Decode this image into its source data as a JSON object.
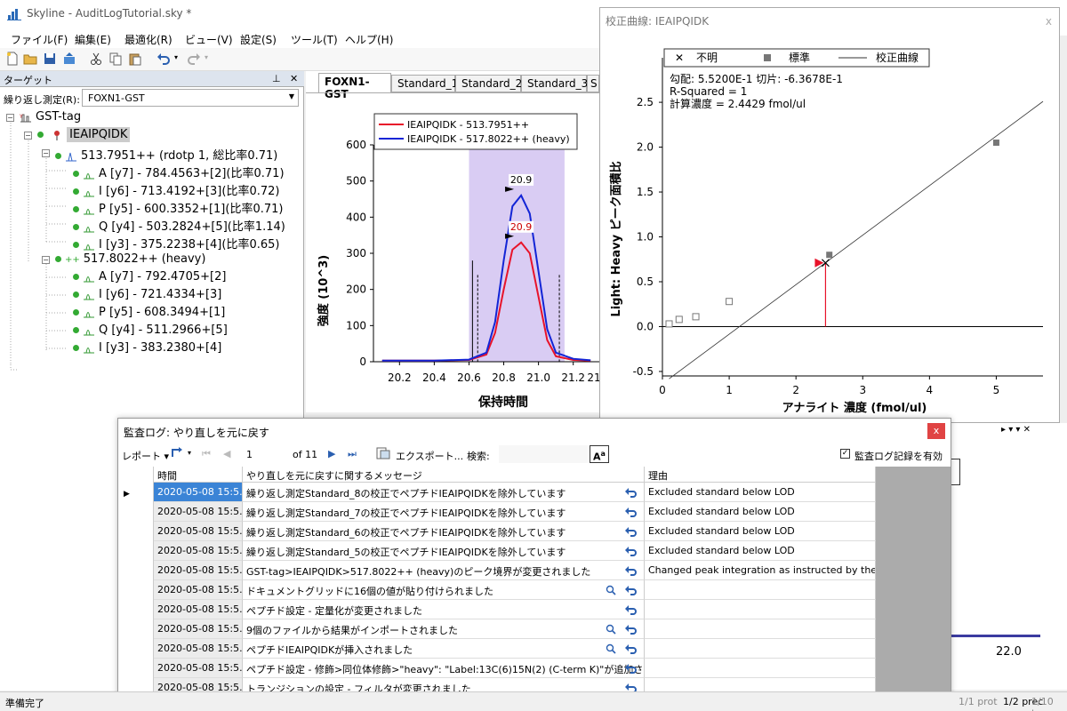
{
  "window": {
    "title": "Skyline - AuditLogTutorial.sky *"
  },
  "menu": [
    "ファイル(F)",
    "編集(E)",
    "最適化(R)",
    "ビュー(V)",
    "設定(S)",
    "ツール(T)",
    "ヘルプ(H)"
  ],
  "targets": {
    "header": "ターゲット",
    "replicate_label": "繰り返し測定(R):",
    "replicate_value": "FOXN1-GST",
    "tree": [
      {
        "text": "GST-tag"
      },
      {
        "text": "IEAIPQIDK"
      },
      {
        "text": "513.7951++ (rdotp 1, 総比率0.71)"
      },
      {
        "text": "A [y7] - 784.4563+[2](比率0.71)"
      },
      {
        "text": "I [y6] - 713.4192+[3](比率0.72)"
      },
      {
        "text": "P [y5] - 600.3352+[1](比率0.71)"
      },
      {
        "text": "Q [y4] - 503.2824+[5](比率1.14)"
      },
      {
        "text": "I [y3] - 375.2238+[4](比率0.65)"
      },
      {
        "text": "517.8022++ (heavy)"
      },
      {
        "text": "A [y7] - 792.4705+[2]"
      },
      {
        "text": "I [y6] - 721.4334+[3]"
      },
      {
        "text": "P [y5] - 608.3494+[1]"
      },
      {
        "text": "Q [y4] - 511.2966+[5]"
      },
      {
        "text": "I [y3] - 383.2380+[4]"
      }
    ]
  },
  "chrom": {
    "tabs": [
      "FOXN1-GST",
      "Standard_1",
      "Standard_2",
      "Standard_3",
      "S"
    ],
    "legend": [
      "IEAIPQIDK - 513.7951++",
      "IEAIPQIDK - 517.8022++ (heavy)"
    ],
    "ylabel": "強度 (10^3)",
    "xlabel": "保持時間",
    "yticks": [
      "600",
      "500",
      "400",
      "300",
      "200",
      "100",
      "0"
    ],
    "xticks": [
      "20.2",
      "20.4",
      "20.6",
      "20.8",
      "21.0",
      "21.2"
    ],
    "xticks_last_partial": "21",
    "peak_labels": [
      "20.9",
      "20.9"
    ],
    "colors": {
      "light": "#e8132a",
      "heavy": "#1325d6",
      "band": "#d9ccf3"
    }
  },
  "chart_data": {
    "type": "line",
    "title": "",
    "xlabel": "保持時間",
    "ylabel": "強度 (10^3)",
    "xlim": [
      20.05,
      21.35
    ],
    "ylim": [
      0,
      600
    ],
    "series": [
      {
        "name": "IEAIPQIDK - 513.7951++",
        "x": [
          20.1,
          20.4,
          20.6,
          20.7,
          20.75,
          20.8,
          20.85,
          20.9,
          20.95,
          21.0,
          21.05,
          21.1,
          21.2,
          21.3
        ],
        "y": [
          3,
          3,
          5,
          20,
          80,
          200,
          310,
          330,
          300,
          180,
          60,
          15,
          5,
          3
        ]
      },
      {
        "name": "IEAIPQIDK - 517.8022++ (heavy)",
        "x": [
          20.1,
          20.4,
          20.6,
          20.7,
          20.75,
          20.8,
          20.85,
          20.9,
          20.95,
          21.0,
          21.05,
          21.1,
          21.2,
          21.3
        ],
        "y": [
          3,
          3,
          6,
          25,
          110,
          280,
          430,
          460,
          410,
          250,
          90,
          25,
          8,
          4
        ]
      }
    ]
  },
  "calib": {
    "title": "校正曲線: IEAIPQIDK",
    "close": "x",
    "legend": [
      "不明",
      "標準",
      "校正曲線"
    ],
    "stats": [
      "勾配: 5.5200E-1 切片: -6.3678E-1",
      "R-Squared = 1",
      "計算濃度 = 2.4429 fmol/ul"
    ],
    "ylabel": "Light: Heavy ピーク面積比",
    "xlabel": "アナライト 濃度 (fmol/ul)",
    "yticks": [
      "2.5",
      "2.0",
      "1.5",
      "1.0",
      "0.5",
      "0.0",
      "-0.5"
    ],
    "xticks": [
      "0",
      "1",
      "2",
      "3",
      "4",
      "5"
    ]
  },
  "calib_data": {
    "type": "scatter",
    "xlabel": "アナライト 濃度 (fmol/ul)",
    "ylabel": "Light: Heavy ピーク面積比",
    "xlim": [
      0,
      5.7
    ],
    "ylim": [
      -0.55,
      2.6
    ],
    "standards_included": [
      {
        "x": 2.5,
        "y": 0.8
      },
      {
        "x": 5.0,
        "y": 2.05
      }
    ],
    "standards_excluded": [
      {
        "x": 0.1,
        "y": 0.03
      },
      {
        "x": 0.25,
        "y": 0.08
      },
      {
        "x": 0.5,
        "y": 0.11
      },
      {
        "x": 1.0,
        "y": 0.28
      }
    ],
    "unknown": {
      "x": 2.4429,
      "y": 0.71
    },
    "fit": {
      "slope": 0.552,
      "intercept": -0.63678
    }
  },
  "right_panel": {
    "tick": "22.0"
  },
  "audit": {
    "title": "監査ログ: やり直しを元に戻す",
    "close": "x",
    "toolbar": {
      "report": "レポート",
      "page": "1",
      "of": "of 11",
      "export": "エクスポート...",
      "search": "検索:",
      "enable": "監査ログ記録を有効"
    },
    "columns": [
      "時間",
      "やり直しを元に戻すに関するメッセージ",
      "理由"
    ],
    "rows": [
      {
        "time": "2020-05-08 15:5...",
        "msg": "繰り返し測定Standard_8の校正でペプチドIEAIPQIDKを除外しています",
        "reason": "Excluded standard below LOD",
        "zoom": false
      },
      {
        "time": "2020-05-08 15:5...",
        "msg": "繰り返し測定Standard_7の校正でペプチドIEAIPQIDKを除外しています",
        "reason": "Excluded standard below LOD",
        "zoom": false
      },
      {
        "time": "2020-05-08 15:5...",
        "msg": "繰り返し測定Standard_6の校正でペプチドIEAIPQIDKを除外しています",
        "reason": "Excluded standard below LOD",
        "zoom": false
      },
      {
        "time": "2020-05-08 15:5...",
        "msg": "繰り返し測定Standard_5の校正でペプチドIEAIPQIDKを除外しています",
        "reason": "Excluded standard below LOD",
        "zoom": false
      },
      {
        "time": "2020-05-08 15:5...",
        "msg": "GST-tag>IEAIPQIDK>517.8022++ (heavy)のピーク境界が変更されました",
        "reason": "Changed peak integration as instructed by the tutorial",
        "zoom": false
      },
      {
        "time": "2020-05-08 15:5...",
        "msg": "ドキュメントグリッドに16個の値が貼り付けられました",
        "reason": "",
        "zoom": true
      },
      {
        "time": "2020-05-08 15:5...",
        "msg": "ペプチド設定 - 定量化が変更されました",
        "reason": "",
        "zoom": false
      },
      {
        "time": "2020-05-08 15:5...",
        "msg": "9個のファイルから結果がインポートされました",
        "reason": "",
        "zoom": true
      },
      {
        "time": "2020-05-08 15:5...",
        "msg": "ペプチドIEAIPQIDKが挿入されました",
        "reason": "",
        "zoom": true
      },
      {
        "time": "2020-05-08 15:5...",
        "msg": "ペプチド設定 - 修飾>同位体修飾>\"heavy\": \"Label:13C(6)15N(2) (C-term K)\"が追加されました",
        "reason": "",
        "zoom": false
      },
      {
        "time": "2020-05-08 15:5...",
        "msg": "トランジションの設定 - フィルタが変更されました",
        "reason": "",
        "zoom": false
      }
    ]
  },
  "status": {
    "ready": "準備完了",
    "right": [
      "1/1 prot",
      "1/1 pep",
      "1/2 prec",
      "1/10 tran"
    ]
  }
}
